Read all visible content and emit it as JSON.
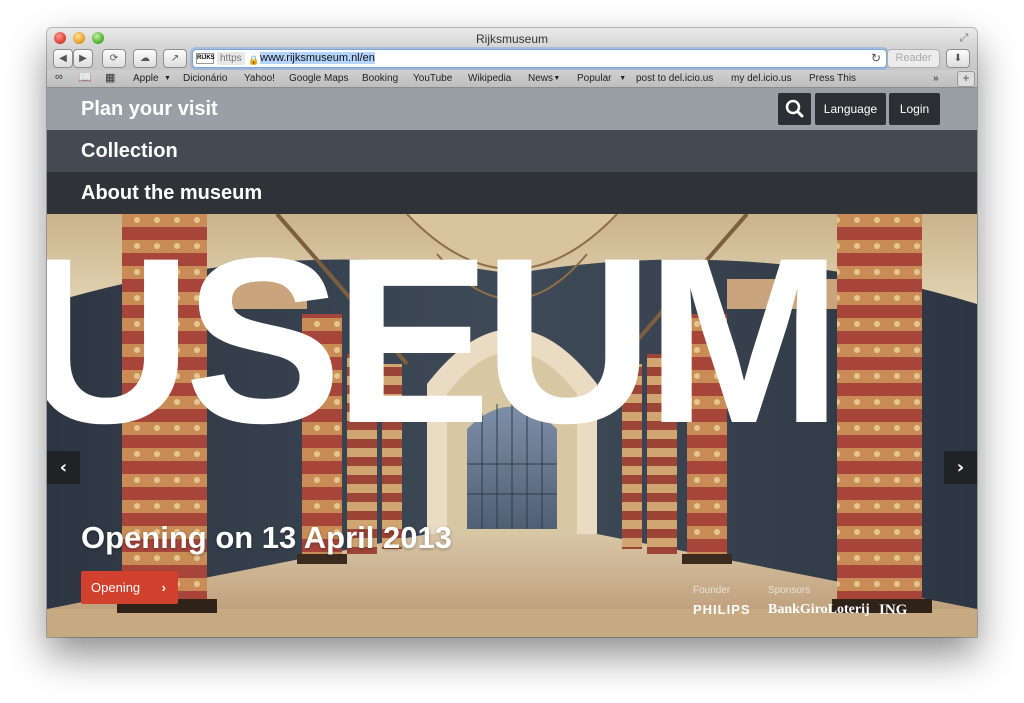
{
  "browser": {
    "window_title": "Rijksmuseum",
    "favicon_text": "RIJKS",
    "https_label": "https",
    "url": "www.rijksmuseum.nl/en",
    "reader_label": "Reader",
    "bookmarks": [
      {
        "label": "Apple",
        "menu": true
      },
      {
        "label": "Dicionário",
        "menu": false
      },
      {
        "label": "Yahoo!",
        "menu": false
      },
      {
        "label": "Google Maps",
        "menu": false
      },
      {
        "label": "Booking",
        "menu": false
      },
      {
        "label": "YouTube",
        "menu": false
      },
      {
        "label": "Wikipedia",
        "menu": false
      },
      {
        "label": "News",
        "menu": true
      },
      {
        "label": "Popular",
        "menu": true
      },
      {
        "label": "post to del.icio.us",
        "menu": false
      },
      {
        "label": "my del.icio.us",
        "menu": false
      },
      {
        "label": "Press This",
        "menu": false
      }
    ],
    "overflow_label": "»",
    "newtab_label": "+"
  },
  "site": {
    "nav": {
      "plan": "Plan your visit",
      "collection": "Collection",
      "about": "About the museum",
      "language": "Language",
      "login": "Login"
    },
    "hero": {
      "watermark": "USEUM",
      "caption": "Opening on 13 April 2013",
      "button": "Opening",
      "founder_label": "Founder",
      "sponsors_label": "Sponsors",
      "founder_logo": "PHILIPS",
      "sponsor_logo_1": "BankGiroLoterij",
      "sponsor_logo_2": "ING"
    }
  },
  "colors": {
    "nav_plan_bg": "#98a0a6",
    "nav_collection_bg": "#444a51",
    "nav_about_bg": "#2f3337",
    "opening_button": "#d2402e"
  }
}
